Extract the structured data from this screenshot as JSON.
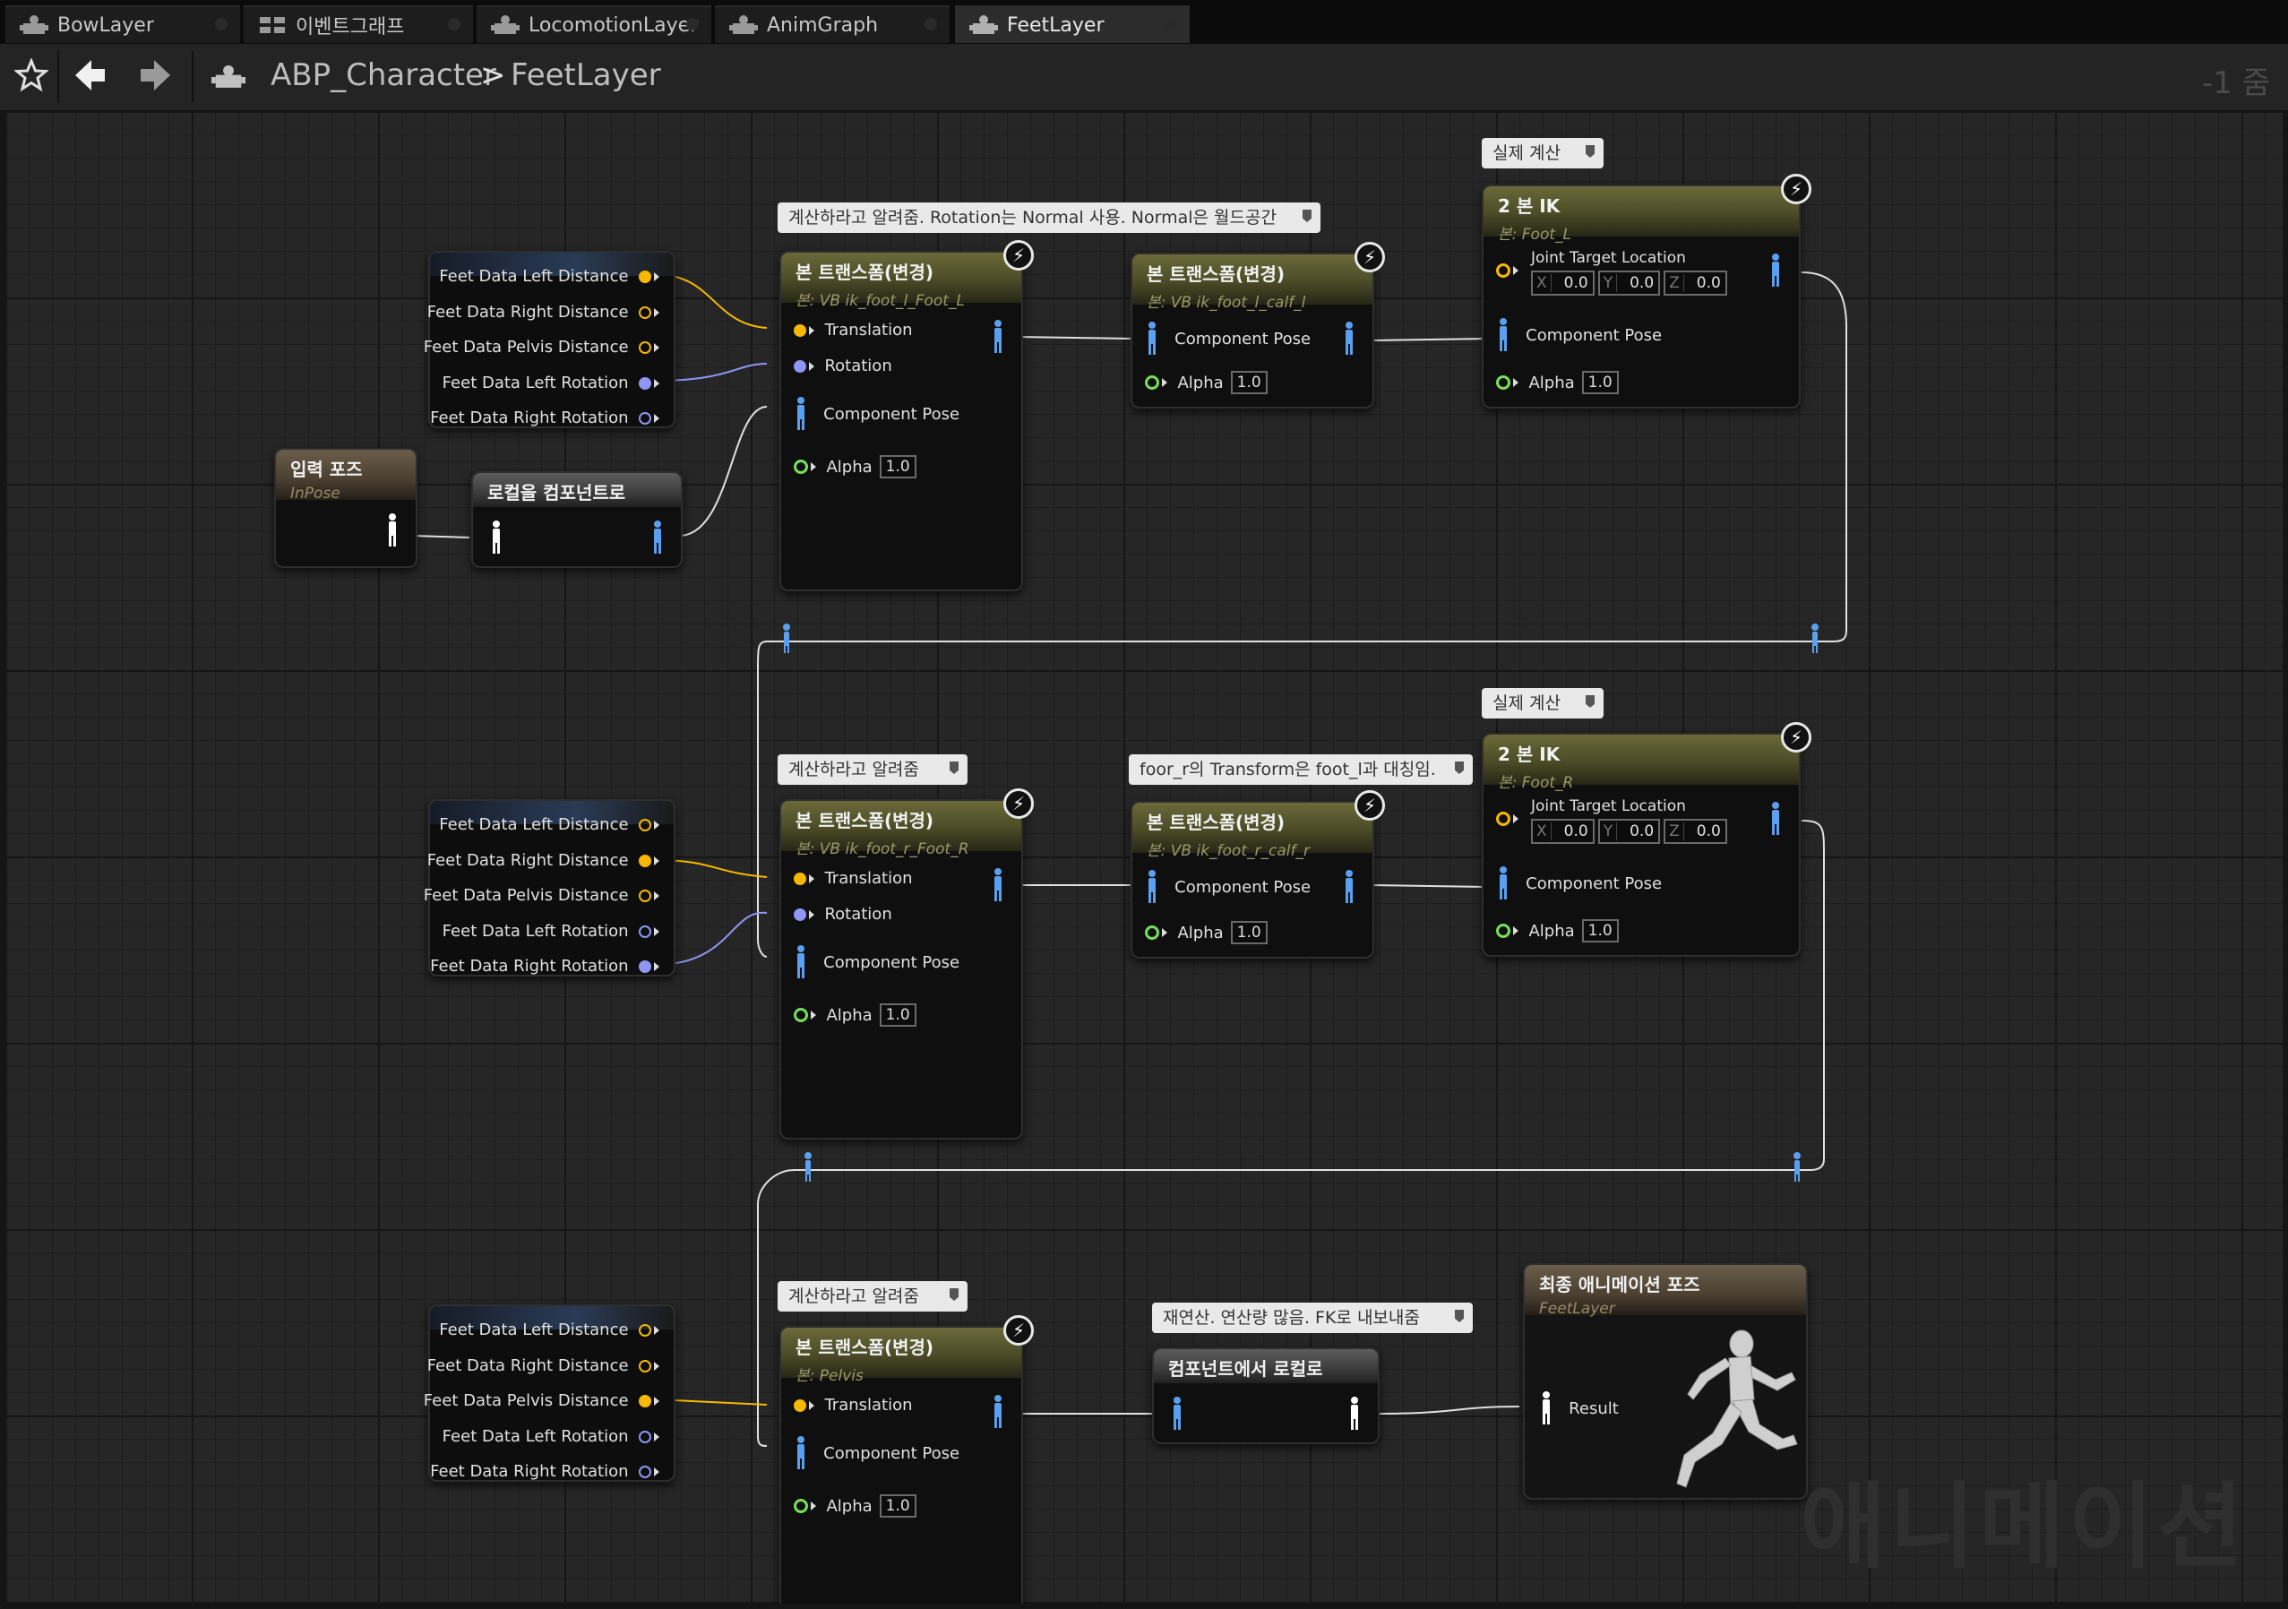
{
  "tabs": [
    {
      "label": "BowLayer",
      "icon": "anim-layer-icon",
      "active": false
    },
    {
      "label": "이벤트그래프",
      "icon": "event-graph-icon",
      "active": false
    },
    {
      "label": "LocomotionLayer",
      "icon": "anim-layer-icon",
      "active": false
    },
    {
      "label": "AnimGraph",
      "icon": "anim-layer-icon",
      "active": false
    },
    {
      "label": "FeetLayer",
      "icon": "anim-layer-icon",
      "active": true
    }
  ],
  "breadcrumb": {
    "root": "ABP_Character",
    "separator": ">",
    "current": "FeetLayer"
  },
  "zoom_label": "-1 줌",
  "watermark": "애니메이션",
  "colors": {
    "float_pin": "#f6b800",
    "rotator_pin": "#8f96f5",
    "exec_pose_pin": "#5aa0f0",
    "alpha_pin": "#76e05a",
    "bone_header": "#4b4b27",
    "result_header": "#4a3f30"
  },
  "feet_data_pins": [
    "Feet Data Left Distance",
    "Feet Data Right Distance",
    "Feet Data Pelvis Distance",
    "Feet Data Left Rotation",
    "Feet Data Right Rotation"
  ],
  "comments": {
    "c1": "계산하라고 알려줌. Rotation는 Normal 사용. Normal은 월드공간",
    "c2": "실제 계산",
    "c3": "계산하라고 알려줌",
    "c4": "foor_r의 Transform은 foot_l과 대칭임.",
    "c5": "실제 계산",
    "c6": "계산하라고 알려줌",
    "c7": "재연산. 연산량 많음. FK로 내보내줌"
  },
  "input_pose": {
    "title": "입력 포즈",
    "subtitle": "InPose"
  },
  "local_to_component": {
    "title": "로컬을 컴포넌트로"
  },
  "component_to_local": {
    "title": "컴포넌트에서 로컬로"
  },
  "output_pose": {
    "title": "최종 애니메이션 포즈",
    "subtitle": "FeetLayer",
    "pin": "Result"
  },
  "bone_transform_title": "본 트랜스폼(변경)",
  "two_bone_ik_title": "2 본 IK",
  "bone_transform_nodes": [
    {
      "bone": "본: VB ik_foot_l_Foot_L",
      "pins": [
        "Translation",
        "Rotation",
        "Component Pose"
      ],
      "alpha_label": "Alpha",
      "alpha": "1.0"
    },
    {
      "bone": "본: VB ik_foot_l_calf_l",
      "pins": [
        "Component Pose"
      ],
      "alpha_label": "Alpha",
      "alpha": "1.0"
    },
    {
      "bone": "본: VB ik_foot_r_Foot_R",
      "pins": [
        "Translation",
        "Rotation",
        "Component Pose"
      ],
      "alpha_label": "Alpha",
      "alpha": "1.0"
    },
    {
      "bone": "본: VB ik_foot_r_calf_r",
      "pins": [
        "Component Pose"
      ],
      "alpha_label": "Alpha",
      "alpha": "1.0"
    },
    {
      "bone": "본: Pelvis",
      "pins": [
        "Translation",
        "Component Pose"
      ],
      "alpha_label": "Alpha",
      "alpha": "1.0"
    }
  ],
  "ik_nodes": [
    {
      "bone": "본: Foot_L",
      "joint_label": "Joint Target Location",
      "x": "0.0",
      "y": "0.0",
      "z": "0.0",
      "pose_label": "Component Pose",
      "alpha_label": "Alpha",
      "alpha": "1.0"
    },
    {
      "bone": "본: Foot_R",
      "joint_label": "Joint Target Location",
      "x": "0.0",
      "y": "0.0",
      "z": "0.0",
      "pose_label": "Component Pose",
      "alpha_label": "Alpha",
      "alpha": "1.0"
    }
  ],
  "axis_labels": {
    "x": "X",
    "y": "Y",
    "z": "Z"
  }
}
